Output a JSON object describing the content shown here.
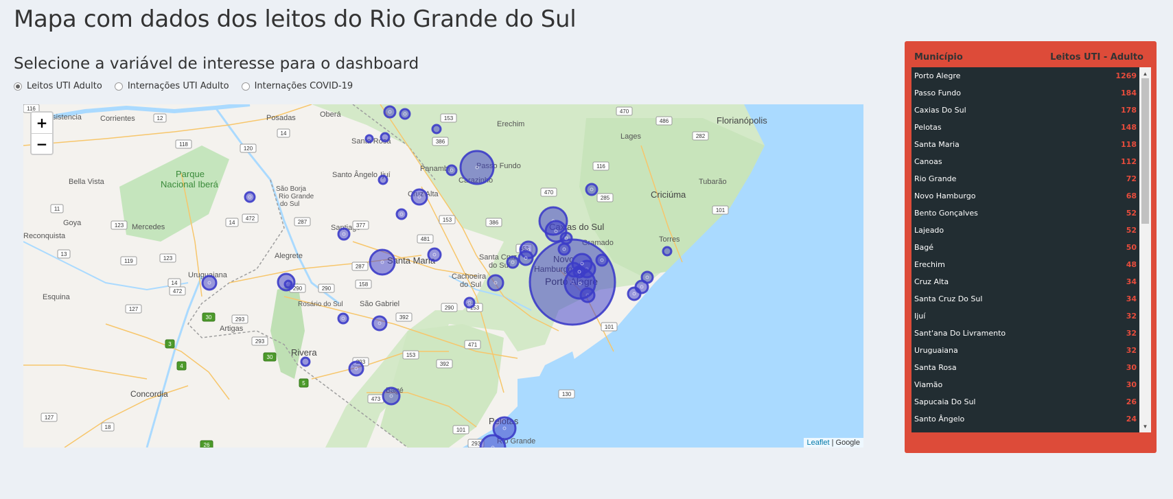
{
  "page": {
    "title": "Mapa com dados dos leitos do Rio Grande do Sul",
    "subtitle": "Selecione a variável de interesse para o dashboard"
  },
  "radios": [
    {
      "label": "Leitos UTI Adulto",
      "checked": true
    },
    {
      "label": "Internações UTI Adulto",
      "checked": false
    },
    {
      "label": "Internações COVID-19",
      "checked": false
    }
  ],
  "map": {
    "zoom_in": "+",
    "zoom_out": "−",
    "attribution_leaflet": "Leaflet",
    "attribution_sep": "|",
    "attribution_google": "Google",
    "labels": {
      "florianopolis": "Florianópolis",
      "lages": "Lages",
      "erechim": "Erechim",
      "passo_fundo": "Passo Fundo",
      "santa_rosa": "Santa Rosa",
      "santo_angelo": "Santo Ângelo",
      "ijui": "Ijuí",
      "panambi": "Panambi",
      "carazinho": "Carazinho",
      "cruz_alta": "Cruz Alta",
      "posadas": "Posadas",
      "obera": "Oberá",
      "corrientes": "Corrientes",
      "resistencia": "esistencia",
      "parque": "Parque",
      "nacional_ibera": "Nacional Iberá",
      "bella_vista": "Bella Vista",
      "goya": "Goya",
      "reconquista": "Reconquista",
      "mercedes": "Mercedes",
      "sao_borja": "São Borja",
      "sao_borja2": "Rio Grande",
      "sao_borja3": "do Sul",
      "santiago": "Santiago",
      "caxias": "Caxias do Sul",
      "gramado": "Gramado",
      "torres": "Torres",
      "tubarao": "Tubarão",
      "criciuma": "Criciúma",
      "santa_maria": "Santa Maria",
      "santa_cruz": "Santa Cruz",
      "santa_cruz2": "do Sul",
      "cachoeira": "Cachoeira",
      "cachoeira2": "do Sul",
      "novo": "Novo",
      "hamburgo": "Hamburgo",
      "porto_alegre": "Porto Alegre",
      "alegrete": "Alegrete",
      "uruguaiana": "Uruguaiana",
      "rosario": "Rosário do Sul",
      "sao_gabriel": "São Gabriel",
      "artigas": "Artigas",
      "esquina": "Esquina",
      "rivera": "Rivera",
      "bage": "Bagé",
      "concordia": "Concordia",
      "pelotas": "Pelotas",
      "rio_grande": "Rio Grande"
    },
    "road_shields": [
      "12",
      "14",
      "153",
      "470",
      "486",
      "282",
      "118",
      "120",
      "386",
      "116",
      "470",
      "285",
      "101",
      "11",
      "123",
      "14",
      "472",
      "287",
      "377",
      "481",
      "153",
      "386",
      "453",
      "13",
      "119",
      "123",
      "287",
      "158",
      "290",
      "14",
      "472",
      "127",
      "290",
      "153",
      "290",
      "392",
      "30",
      "293",
      "101",
      "3",
      "293",
      "471",
      "153",
      "30",
      "4",
      "293",
      "392",
      "5",
      "473",
      "127",
      "18",
      "26",
      "130",
      "101",
      "293",
      "116"
    ]
  },
  "table": {
    "col_municipio": "Município",
    "col_leitos": "Leitos UTI - Adulto",
    "rows": [
      {
        "name": "Porto Alegre",
        "value": "1269"
      },
      {
        "name": "Passo Fundo",
        "value": "184"
      },
      {
        "name": "Caxias Do Sul",
        "value": "178"
      },
      {
        "name": "Pelotas",
        "value": "148"
      },
      {
        "name": "Santa Maria",
        "value": "118"
      },
      {
        "name": "Canoas",
        "value": "112"
      },
      {
        "name": "Rio Grande",
        "value": "72"
      },
      {
        "name": "Novo Hamburgo",
        "value": "68"
      },
      {
        "name": "Bento Gonçalves",
        "value": "52"
      },
      {
        "name": "Lajeado",
        "value": "52"
      },
      {
        "name": "Bagé",
        "value": "50"
      },
      {
        "name": "Erechim",
        "value": "48"
      },
      {
        "name": "Cruz Alta",
        "value": "34"
      },
      {
        "name": "Santa Cruz Do Sul",
        "value": "34"
      },
      {
        "name": "Ijuí",
        "value": "32"
      },
      {
        "name": "Sant'ana Do Livramento",
        "value": "32"
      },
      {
        "name": "Uruguaiana",
        "value": "32"
      },
      {
        "name": "Santa Rosa",
        "value": "30"
      },
      {
        "name": "Viamão",
        "value": "30"
      },
      {
        "name": "Sapucaia Do Sul",
        "value": "26"
      },
      {
        "name": "Santo Ângelo",
        "value": "24"
      }
    ]
  },
  "colors": {
    "background": "#ecf0f5",
    "box": "#dd4b39",
    "table_bg": "#222d32",
    "value_text": "#e74c3c",
    "circle_fill": "#3c3cc8",
    "ocean": "#aadaff",
    "land_green": "#cce8c0"
  }
}
